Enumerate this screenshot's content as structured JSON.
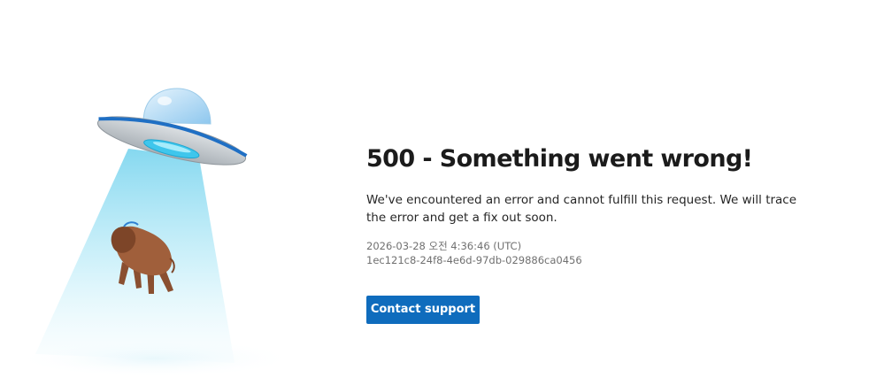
{
  "error": {
    "title": "500 - Something went wrong!",
    "message": "We've encountered an error and cannot fulfill this request. We will trace the error and get a fix out soon.",
    "timestamp": "2026-03-28 오전 4:36:46 (UTC)",
    "correlation_id": "1ec121c8-24f8-4e6d-97db-029886ca0456"
  },
  "actions": {
    "contact_support_label": "Contact support"
  },
  "illustration": {
    "name": "ufo-abducting-bison",
    "colors": {
      "beam": "#b9ecf7",
      "ufo_body": "#c9cfd4",
      "ufo_stripe": "#1f6fc4",
      "dome": "#a9d6f2",
      "bison": "#a05f3b"
    }
  },
  "colors": {
    "accent": "#0f6cbd",
    "title": "#1b1b1b",
    "body_text": "#262626",
    "meta_text": "#707070",
    "background": "#ffffff"
  }
}
